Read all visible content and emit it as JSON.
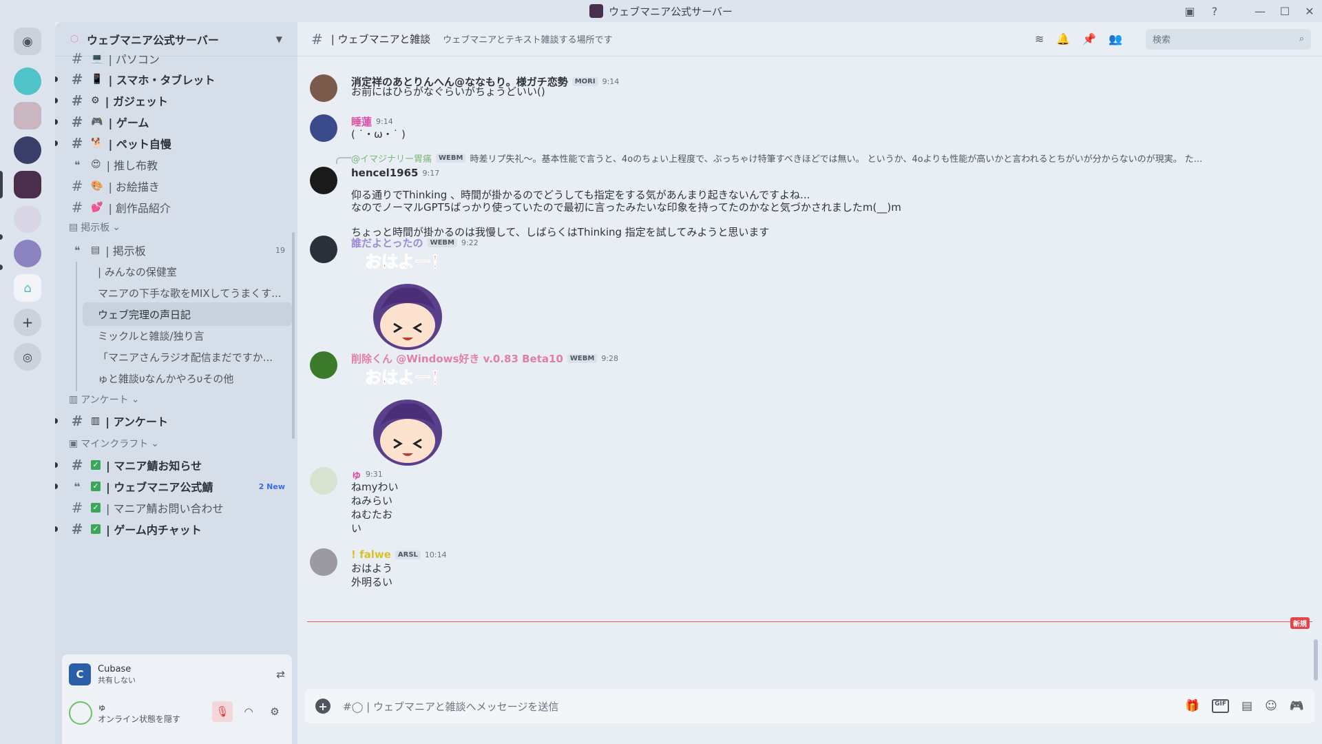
{
  "window": {
    "title": "ウェブマニア公式サーバー"
  },
  "server": {
    "name": "ウェブマニア公式サーバー"
  },
  "sidebar": {
    "channels": [
      {
        "label": "| パソコン",
        "icon": "hash",
        "emoji": "💻",
        "unread": false
      },
      {
        "label": "| スマホ・タブレット",
        "icon": "hash",
        "emoji": "📱",
        "unread": true
      },
      {
        "label": "| ガジェット",
        "icon": "hash",
        "emoji": "⚙",
        "unread": true
      },
      {
        "label": "| ゲーム",
        "icon": "hash",
        "emoji": "🎮",
        "unread": true
      },
      {
        "label": "| ペット自慢",
        "icon": "hash",
        "emoji": "🐕",
        "unread": true
      },
      {
        "label": "| 推し布教",
        "icon": "forum",
        "emoji": "😍",
        "unread": false
      },
      {
        "label": "| お絵描き",
        "icon": "hash",
        "emoji": "🎨",
        "unread": false
      },
      {
        "label": "| 創作品紹介",
        "icon": "hash",
        "emoji": "💕",
        "unread": false
      }
    ],
    "category_board": "掲示板",
    "board_channel": {
      "label": "| 掲示板",
      "count": "19"
    },
    "threads": [
      "| みんなの保健室",
      "マニアの下手な歌をMIXしてうまくす...",
      "ウェブ完理の声日記",
      "ミックルと雑談/独り言",
      "「マニアさんラジオ配信まだですか...",
      "ゅと雑談υなんかやろυその他"
    ],
    "category_survey": "アンケート",
    "survey_channel": "| アンケート",
    "category_minecraft": "マインクラフト",
    "mc_channels": [
      {
        "label": "| マニア鯖お知らせ",
        "unread": true,
        "badge": ""
      },
      {
        "label": "| ウェブマニア公式鯖",
        "unread": true,
        "badge": "2 New"
      },
      {
        "label": "| マニア鯖お問い合わせ",
        "unread": false,
        "badge": ""
      },
      {
        "label": "| ゲーム内チャット",
        "unread": true,
        "badge": ""
      }
    ]
  },
  "activity": {
    "app": "Cubase",
    "status": "共有しない"
  },
  "user": {
    "name": "ゅ",
    "status": "オンライン状態を隠す"
  },
  "chat_header": {
    "channel": "| ウェブマニアと雑談",
    "topic": "ウェブマニアとテキスト雑談する場所です",
    "search_placeholder": "検索"
  },
  "messages": [
    {
      "author": "消定祥のあとりんへん@ななもり。様ガチ恋勢",
      "tag": "MORI",
      "time": "9:14",
      "lines": [
        "お前にはひらがなぐらいがちょうどいい()"
      ],
      "color": "#2e3338"
    },
    {
      "author": "睡蓮",
      "tag": "",
      "time": "9:14",
      "lines": [
        "( ˙・ω・˙ )"
      ],
      "color": "#e04fa8"
    },
    {
      "author": "hencel1965",
      "tag": "",
      "time": "9:17",
      "reply_author": "@イマジナリー胃痛",
      "reply_tag": "WEBM",
      "reply_text": "時差リプ失礼〜。基本性能で言うと、4oのちょい上程度で、ぶっちゃけ特筆すべきほどでは無い。 というか、4oよりも性能が高いかと言われるとちがいが分からないのが現実。 た...",
      "lines": [
        "仰る通りでThinking 、時間が掛かるのでどうしても指定をする気があんまり起きないんですよね...",
        "なのでノーマルGPT5ばっかり使っていたので最初に言ったみたいな印象を持ってたのかなと気づかされましたm(__)m",
        "",
        "ちょっと時間が掛かるのは我慢して、しばらくはThinking 指定を試してみようと思います"
      ],
      "color": "#2e3338"
    },
    {
      "author": "誰だよとったの",
      "tag": "WEBM",
      "time": "9:22",
      "sticker": "おはよー！",
      "color": "#9b8ad6"
    },
    {
      "author": "削除くん @Windows好き v.0.83 Beta10",
      "tag": "WEBM",
      "time": "9:28",
      "sticker": "おはよー！",
      "color": "#e07fa8"
    },
    {
      "author": "ゅ",
      "tag": "",
      "time": "9:31",
      "lines": [
        "ねmyわい",
        "ねみらい",
        "ねむたお",
        "い"
      ],
      "color": "#e04fa8"
    },
    {
      "author": "! falwe",
      "tag": "ARSL",
      "time": "10:14",
      "lines": [
        "おはよう",
        "外明るい"
      ],
      "color": "#d9c12e"
    }
  ],
  "new_label": "新規",
  "composer": {
    "placeholder": "#◯ | ウェブマニアと雑談へメッセージを送信"
  },
  "colors": {
    "accent": "#5865f2",
    "unread_marker": "#e0454a",
    "muted_red": "#d83c3e"
  }
}
